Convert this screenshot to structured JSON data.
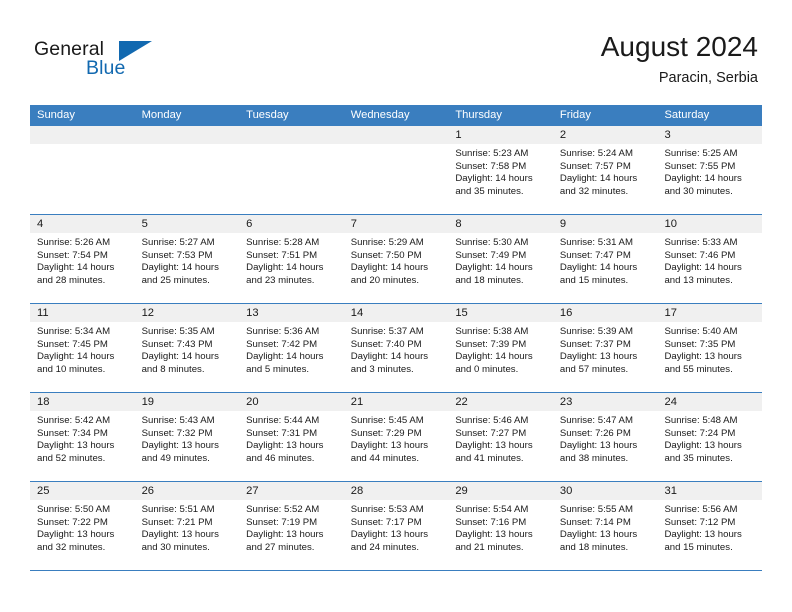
{
  "brand": {
    "name_top": "General",
    "name_bottom": "Blue",
    "accent_color": "#1269b0"
  },
  "header": {
    "title": "August 2024",
    "subtitle": "Paracin, Serbia"
  },
  "calendar": {
    "header_bg": "#3a7ebf",
    "day_band_bg": "#f0f0f0",
    "weekdays": [
      "Sunday",
      "Monday",
      "Tuesday",
      "Wednesday",
      "Thursday",
      "Friday",
      "Saturday"
    ],
    "weeks": [
      [
        {
          "day": "",
          "lines": []
        },
        {
          "day": "",
          "lines": []
        },
        {
          "day": "",
          "lines": []
        },
        {
          "day": "",
          "lines": []
        },
        {
          "day": "1",
          "lines": [
            "Sunrise: 5:23 AM",
            "Sunset: 7:58 PM",
            "Daylight: 14 hours",
            "and 35 minutes."
          ]
        },
        {
          "day": "2",
          "lines": [
            "Sunrise: 5:24 AM",
            "Sunset: 7:57 PM",
            "Daylight: 14 hours",
            "and 32 minutes."
          ]
        },
        {
          "day": "3",
          "lines": [
            "Sunrise: 5:25 AM",
            "Sunset: 7:55 PM",
            "Daylight: 14 hours",
            "and 30 minutes."
          ]
        }
      ],
      [
        {
          "day": "4",
          "lines": [
            "Sunrise: 5:26 AM",
            "Sunset: 7:54 PM",
            "Daylight: 14 hours",
            "and 28 minutes."
          ]
        },
        {
          "day": "5",
          "lines": [
            "Sunrise: 5:27 AM",
            "Sunset: 7:53 PM",
            "Daylight: 14 hours",
            "and 25 minutes."
          ]
        },
        {
          "day": "6",
          "lines": [
            "Sunrise: 5:28 AM",
            "Sunset: 7:51 PM",
            "Daylight: 14 hours",
            "and 23 minutes."
          ]
        },
        {
          "day": "7",
          "lines": [
            "Sunrise: 5:29 AM",
            "Sunset: 7:50 PM",
            "Daylight: 14 hours",
            "and 20 minutes."
          ]
        },
        {
          "day": "8",
          "lines": [
            "Sunrise: 5:30 AM",
            "Sunset: 7:49 PM",
            "Daylight: 14 hours",
            "and 18 minutes."
          ]
        },
        {
          "day": "9",
          "lines": [
            "Sunrise: 5:31 AM",
            "Sunset: 7:47 PM",
            "Daylight: 14 hours",
            "and 15 minutes."
          ]
        },
        {
          "day": "10",
          "lines": [
            "Sunrise: 5:33 AM",
            "Sunset: 7:46 PM",
            "Daylight: 14 hours",
            "and 13 minutes."
          ]
        }
      ],
      [
        {
          "day": "11",
          "lines": [
            "Sunrise: 5:34 AM",
            "Sunset: 7:45 PM",
            "Daylight: 14 hours",
            "and 10 minutes."
          ]
        },
        {
          "day": "12",
          "lines": [
            "Sunrise: 5:35 AM",
            "Sunset: 7:43 PM",
            "Daylight: 14 hours",
            "and 8 minutes."
          ]
        },
        {
          "day": "13",
          "lines": [
            "Sunrise: 5:36 AM",
            "Sunset: 7:42 PM",
            "Daylight: 14 hours",
            "and 5 minutes."
          ]
        },
        {
          "day": "14",
          "lines": [
            "Sunrise: 5:37 AM",
            "Sunset: 7:40 PM",
            "Daylight: 14 hours",
            "and 3 minutes."
          ]
        },
        {
          "day": "15",
          "lines": [
            "Sunrise: 5:38 AM",
            "Sunset: 7:39 PM",
            "Daylight: 14 hours",
            "and 0 minutes."
          ]
        },
        {
          "day": "16",
          "lines": [
            "Sunrise: 5:39 AM",
            "Sunset: 7:37 PM",
            "Daylight: 13 hours",
            "and 57 minutes."
          ]
        },
        {
          "day": "17",
          "lines": [
            "Sunrise: 5:40 AM",
            "Sunset: 7:35 PM",
            "Daylight: 13 hours",
            "and 55 minutes."
          ]
        }
      ],
      [
        {
          "day": "18",
          "lines": [
            "Sunrise: 5:42 AM",
            "Sunset: 7:34 PM",
            "Daylight: 13 hours",
            "and 52 minutes."
          ]
        },
        {
          "day": "19",
          "lines": [
            "Sunrise: 5:43 AM",
            "Sunset: 7:32 PM",
            "Daylight: 13 hours",
            "and 49 minutes."
          ]
        },
        {
          "day": "20",
          "lines": [
            "Sunrise: 5:44 AM",
            "Sunset: 7:31 PM",
            "Daylight: 13 hours",
            "and 46 minutes."
          ]
        },
        {
          "day": "21",
          "lines": [
            "Sunrise: 5:45 AM",
            "Sunset: 7:29 PM",
            "Daylight: 13 hours",
            "and 44 minutes."
          ]
        },
        {
          "day": "22",
          "lines": [
            "Sunrise: 5:46 AM",
            "Sunset: 7:27 PM",
            "Daylight: 13 hours",
            "and 41 minutes."
          ]
        },
        {
          "day": "23",
          "lines": [
            "Sunrise: 5:47 AM",
            "Sunset: 7:26 PM",
            "Daylight: 13 hours",
            "and 38 minutes."
          ]
        },
        {
          "day": "24",
          "lines": [
            "Sunrise: 5:48 AM",
            "Sunset: 7:24 PM",
            "Daylight: 13 hours",
            "and 35 minutes."
          ]
        }
      ],
      [
        {
          "day": "25",
          "lines": [
            "Sunrise: 5:50 AM",
            "Sunset: 7:22 PM",
            "Daylight: 13 hours",
            "and 32 minutes."
          ]
        },
        {
          "day": "26",
          "lines": [
            "Sunrise: 5:51 AM",
            "Sunset: 7:21 PM",
            "Daylight: 13 hours",
            "and 30 minutes."
          ]
        },
        {
          "day": "27",
          "lines": [
            "Sunrise: 5:52 AM",
            "Sunset: 7:19 PM",
            "Daylight: 13 hours",
            "and 27 minutes."
          ]
        },
        {
          "day": "28",
          "lines": [
            "Sunrise: 5:53 AM",
            "Sunset: 7:17 PM",
            "Daylight: 13 hours",
            "and 24 minutes."
          ]
        },
        {
          "day": "29",
          "lines": [
            "Sunrise: 5:54 AM",
            "Sunset: 7:16 PM",
            "Daylight: 13 hours",
            "and 21 minutes."
          ]
        },
        {
          "day": "30",
          "lines": [
            "Sunrise: 5:55 AM",
            "Sunset: 7:14 PM",
            "Daylight: 13 hours",
            "and 18 minutes."
          ]
        },
        {
          "day": "31",
          "lines": [
            "Sunrise: 5:56 AM",
            "Sunset: 7:12 PM",
            "Daylight: 13 hours",
            "and 15 minutes."
          ]
        }
      ]
    ]
  }
}
